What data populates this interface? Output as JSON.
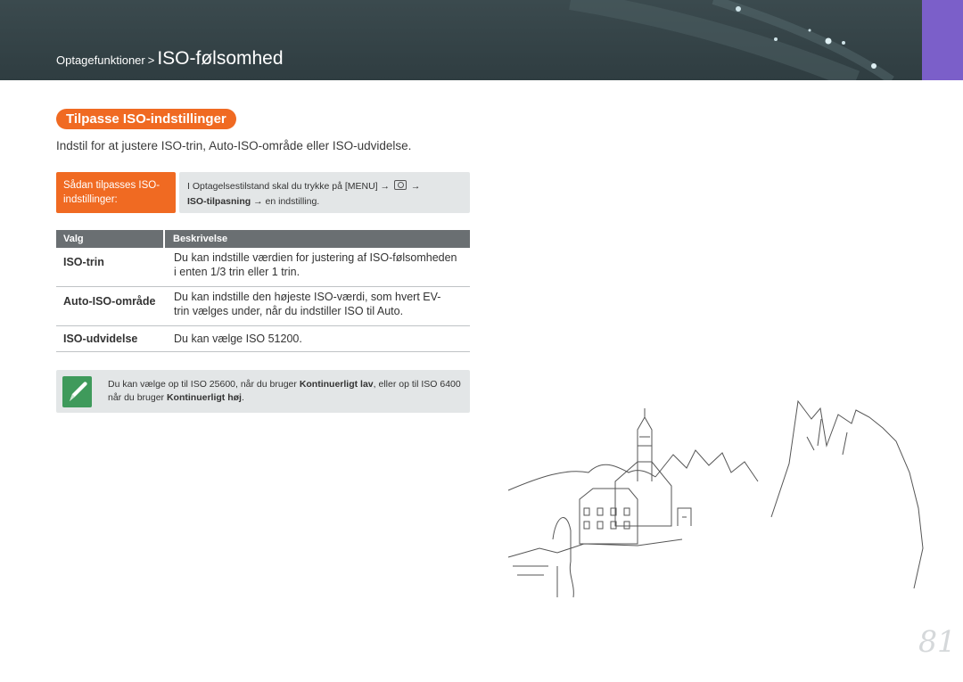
{
  "header": {
    "breadcrumb_parent": "Optagefunktioner",
    "breadcrumb_separator": ">",
    "breadcrumb_current": "ISO-følsomhed",
    "background_color": "#34444a",
    "side_tab_color": "#7b5fc9"
  },
  "section": {
    "title": "Tilpasse ISO-indstillinger",
    "intro": "Indstil for at justere ISO-trin, Auto-ISO-område eller ISO-udvidelse.",
    "accent_color": "#f06a22"
  },
  "how_to": {
    "label_line1": "Sådan tilpasses ISO-",
    "label_line2": "indstillinger:",
    "step_line1_prefix": "I Optagelsestilstand skal du trykke på",
    "menu_key": "[MENU]",
    "arrow": "→",
    "camera_icon": "camera-icon",
    "step_line2_bold": "ISO-tilpasning",
    "step_line2_rest": "→ en indstilling."
  },
  "table": {
    "headers": [
      "Valg",
      "Beskrivelse"
    ],
    "rows": [
      {
        "option": "ISO-trin",
        "desc_line1": "Du kan indstille værdien for justering af ISO-følsomheden",
        "desc_line2": "i enten 1/3 trin eller 1 trin."
      },
      {
        "option": "Auto-ISO-område",
        "desc_line1": "Du kan indstille den højeste ISO-værdi, som hvert EV-",
        "desc_line2": "trin vælges under, når du indstiller ISO til Auto."
      },
      {
        "option": "ISO-udvidelse",
        "desc_line1": "Du kan vælge ISO 51200.",
        "desc_line2": ""
      }
    ]
  },
  "note": {
    "icon": "pencil-note-icon",
    "icon_color": "#3f9a5b",
    "part1": "Du kan vælge op til ISO 25600, når du bruger",
    "bold1": "Kontinuerligt lav",
    "part2": ", eller op til ISO 6400 når du bruger",
    "bold2": "Kontinuerligt høj",
    "part3": "."
  },
  "page_number": "81"
}
